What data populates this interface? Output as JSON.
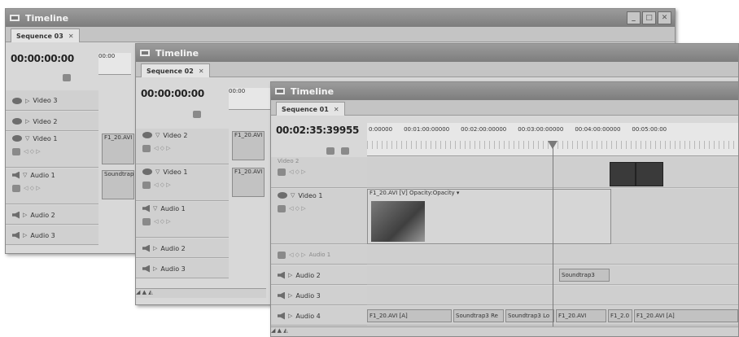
{
  "windows": [
    {
      "title": "Timeline",
      "tab": "Sequence 03",
      "timecode": "00:00:00:00",
      "ruler_label": "00:00",
      "tracks": [
        "Video 3",
        "Video 2",
        "Video 1",
        "Audio 1",
        "Audio 2",
        "Audio 3"
      ],
      "clips": [
        "F1_20.AVI",
        "Soundtrap"
      ]
    },
    {
      "title": "Timeline",
      "tab": "Sequence 02",
      "timecode": "00:00:00:00",
      "ruler_label": "00:00",
      "tracks": [
        "Video 2",
        "Video 1",
        "Audio 1",
        "Audio 2",
        "Audio 3"
      ],
      "clips": [
        "F1_20.AVI",
        "F1_20.AVI"
      ]
    },
    {
      "title": "Timeline",
      "tab": "Sequence 01",
      "timecode": "00:02:35:39955",
      "ruler_ticks": [
        "0:00000",
        "00:01:00:00000",
        "00:02:00:00000",
        "00:03:00:00000",
        "00:04:00:00000",
        "00:05:00:00"
      ],
      "tracks": [
        "Video 2",
        "Video 1",
        "Audio 1",
        "Audio 2",
        "Audio 3",
        "Audio 4"
      ],
      "video1_clip": "F1_20.AVI [V] Opacity:Opacity ▾",
      "audio2_clip": "Soundtrap3",
      "audio4_clips": [
        "F1_20.AVI [A]",
        "Soundtrap3 Re",
        "Soundtrap3 Lo",
        "F1_20.AVI",
        "F1_2.0",
        "F1_20.AVI [A]"
      ]
    }
  ],
  "colors": {
    "title_bar": "#8a8a8a",
    "panel": "#d8d8d8",
    "playhead": "#7a7a7a"
  },
  "icons": [
    "eye-icon",
    "speaker-icon",
    "lock-icon",
    "collapse-triangle-icon",
    "keyframe-nav-icon",
    "zoom-slider-icon"
  ]
}
